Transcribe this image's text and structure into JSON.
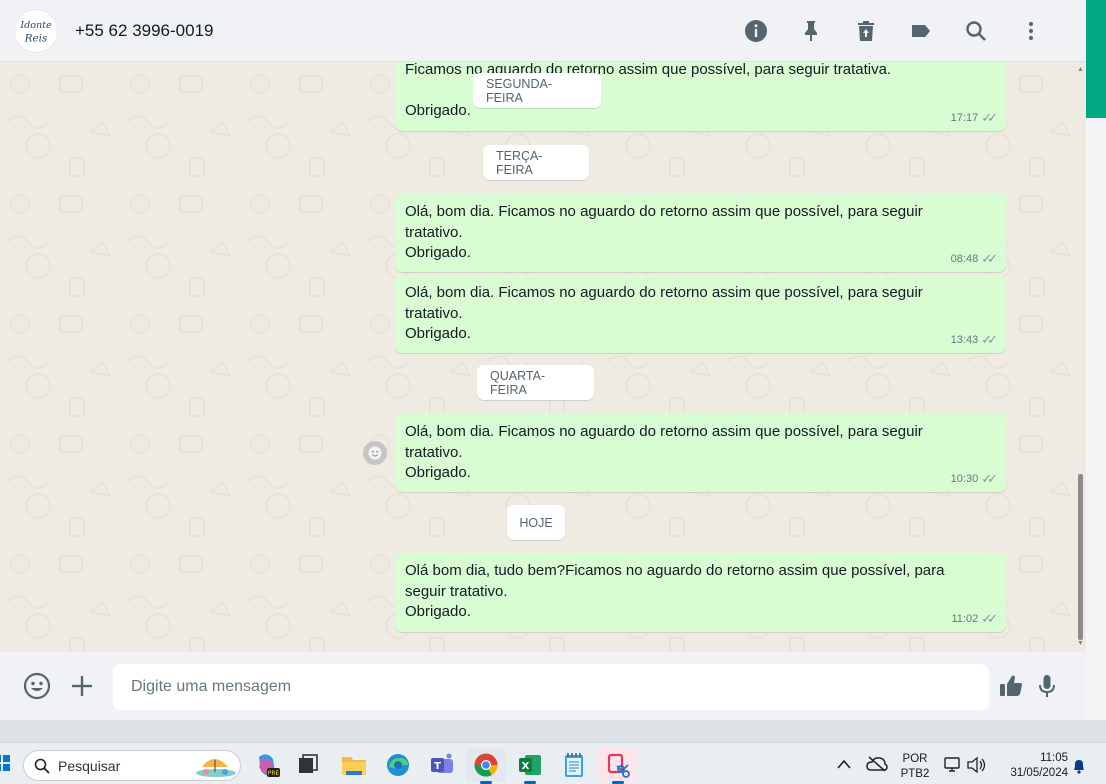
{
  "header": {
    "avatar_text_line1": "Idonte",
    "avatar_text_line2": "Reis",
    "contact_name": "+55 62 3996-0019",
    "actions": [
      "info-icon",
      "pin-icon",
      "trash-icon",
      "label-icon",
      "search-icon",
      "menu-icon"
    ]
  },
  "chat": {
    "date_pills": {
      "monday": "SEGUNDA-FEIRA",
      "tuesday": "TERÇA-FEIRA",
      "wednesday": "QUARTA-FEIRA",
      "today": "HOJE"
    },
    "messages": [
      {
        "line1": "Ficamos no aguardo do retorno assim que possível, para seguir tratativa.",
        "line2": "",
        "line3": "Obrigado.",
        "time": "17:17"
      },
      {
        "line1": "Olá, bom dia. Ficamos no aguardo do retorno assim que possível, para seguir",
        "line2": "tratativo.",
        "line3": "Obrigado.",
        "time": "08:48"
      },
      {
        "line1": "Olá, bom dia. Ficamos no aguardo do retorno assim que possível, para seguir",
        "line2": "tratativo.",
        "line3": "Obrigado.",
        "time": "13:43"
      },
      {
        "line1": "Olá, bom dia. Ficamos no aguardo do retorno assim que possível, para seguir",
        "line2": "tratativo.",
        "line3": "Obrigado.",
        "time": "10:30"
      },
      {
        "line1": "Olá bom dia, tudo bem?Ficamos no aguardo do retorno assim que possível, para",
        "line2": "seguir tratativo.",
        "line3": "Obrigado.",
        "time": "11:02"
      }
    ],
    "ticks": "✓✓"
  },
  "compose": {
    "placeholder": "Digite uma mensagem",
    "icons": [
      "emoji-icon",
      "plus-icon",
      "thumbs-up-icon",
      "microphone-icon"
    ]
  },
  "taskbar": {
    "search_label": "Pesquisar",
    "lang_line1": "POR",
    "lang_line2": "PTB2",
    "time": "11:05",
    "date": "31/05/2024"
  },
  "colors": {
    "bubble_green": "#d9fdd3",
    "accent": "#00a884",
    "header_bg": "#f0f2f5",
    "chat_bg": "#efeae2"
  }
}
